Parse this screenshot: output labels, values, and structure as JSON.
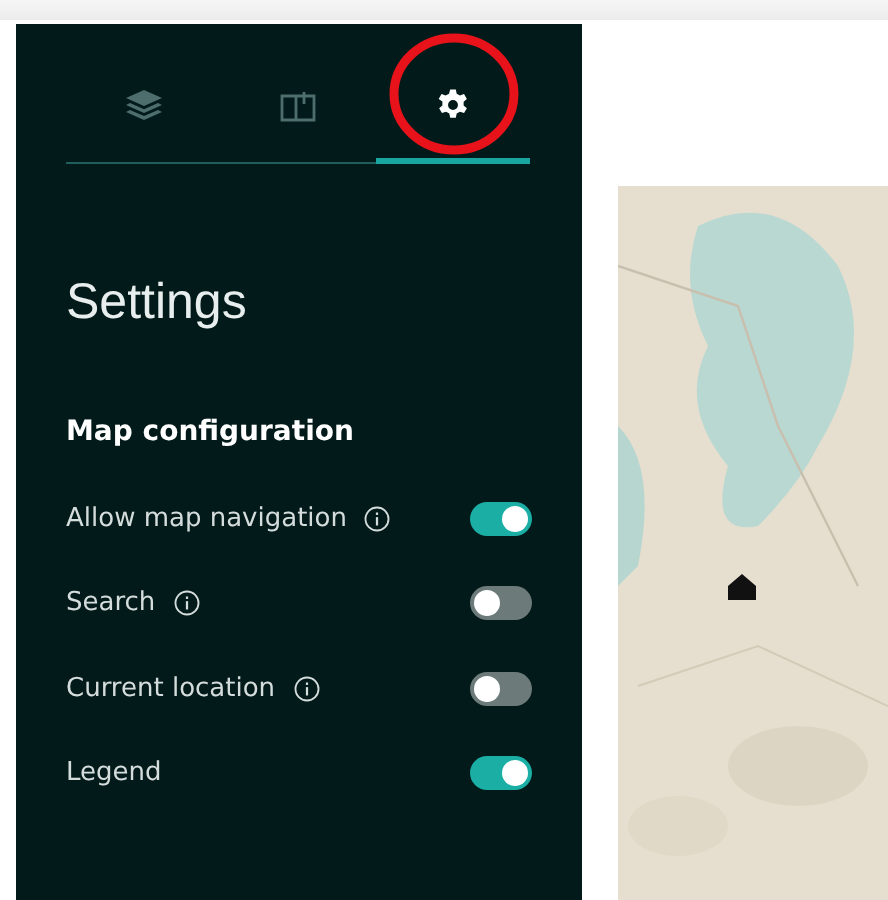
{
  "tabs": [
    {
      "kind": "layers",
      "selected": false
    },
    {
      "kind": "book",
      "selected": false
    },
    {
      "kind": "settings",
      "selected": true,
      "highlighted": true
    }
  ],
  "panel": {
    "title": "Settings",
    "section": "Map configuration",
    "options": [
      {
        "label": "Allow map navigation",
        "info": true,
        "on": true
      },
      {
        "label": "Search",
        "info": true,
        "on": false
      },
      {
        "label": "Current location",
        "info": true,
        "on": false
      },
      {
        "label": "Legend",
        "info": false,
        "on": true
      }
    ]
  }
}
